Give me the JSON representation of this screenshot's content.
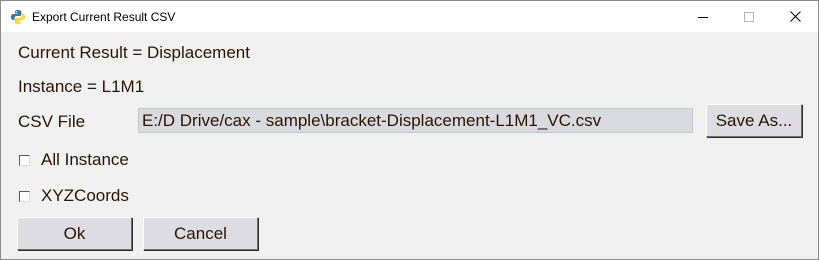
{
  "window": {
    "title": "Export Current Result CSV",
    "app_icon": "python-icon"
  },
  "titlebar_buttons": {
    "minimize_icon": "minimize-icon",
    "maximize_icon": "maximize-icon",
    "close_icon": "close-icon"
  },
  "form": {
    "current_result_label": "Current Result = Displacement",
    "instance_label": "Instance = L1M1",
    "csv_file_label": "CSV File",
    "csv_file_value": "E:/D Drive/cax - sample\\bracket-Displacement-L1M1_VC.csv",
    "save_as_label": "Save As...",
    "all_instance_label": "All Instance",
    "all_instance_checked": false,
    "xyzcoords_label": "XYZCoords",
    "xyzcoords_checked": false
  },
  "actions": {
    "ok_label": "Ok",
    "cancel_label": "Cancel"
  },
  "colors": {
    "text": "#2d1400",
    "background": "#f0f0f0",
    "field_background": "#d9d9e0",
    "python_blue": "#3776ab",
    "python_yellow": "#ffd43b"
  }
}
